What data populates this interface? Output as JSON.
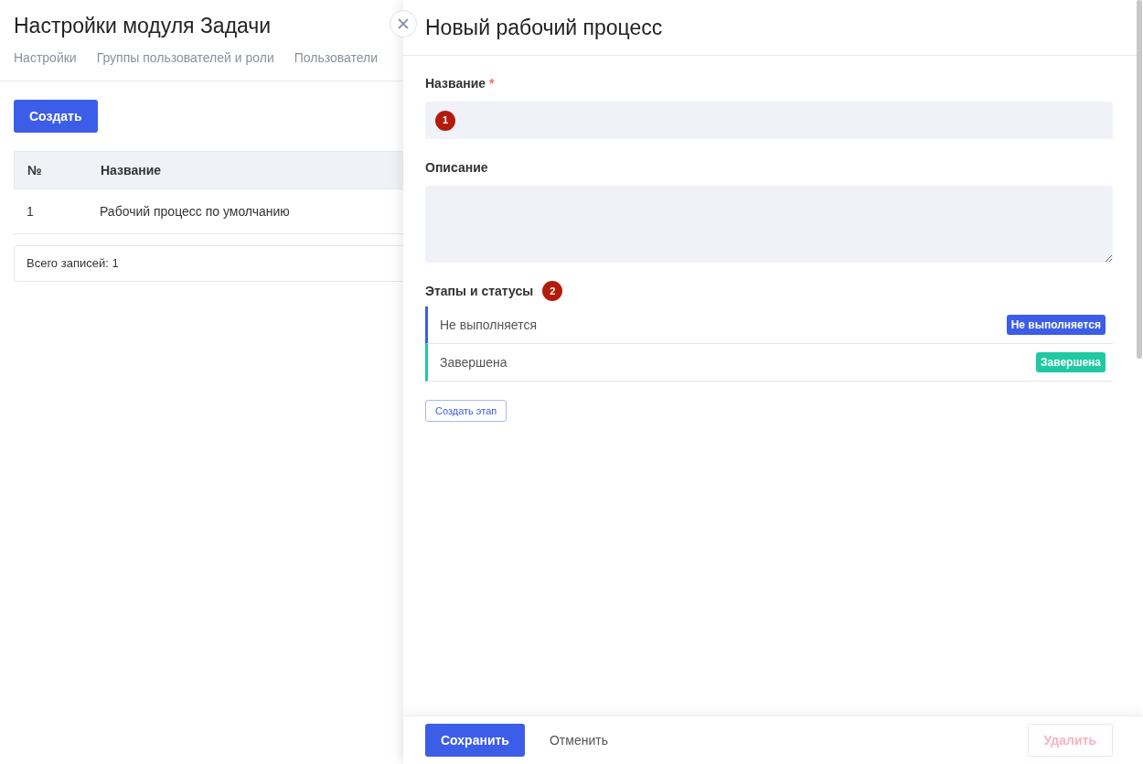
{
  "page": {
    "title": "Настройки модуля Задачи",
    "tabs": [
      {
        "label": "Настройки",
        "selected": false
      },
      {
        "label": "Группы пользователей и роли",
        "selected": false
      },
      {
        "label": "Пользователи",
        "selected": false
      }
    ],
    "create_button": "Создать",
    "table": {
      "columns": [
        "№",
        "Название"
      ],
      "rows": [
        [
          "1",
          "Рабочий процесс по умолчанию"
        ]
      ]
    },
    "total": "Всего записей: 1"
  },
  "drawer": {
    "title": "Новый рабочий процесс",
    "name_field": {
      "label": "Название",
      "required_mark": "*",
      "marker": "1"
    },
    "description_field": {
      "label": "Описание"
    },
    "stages": {
      "label": "Этапы и статусы",
      "marker": "2",
      "items": [
        {
          "name": "Не выполняется",
          "status": "Не выполняется",
          "color": "#3b5de7"
        },
        {
          "name": "Завершена",
          "status": "Завершена",
          "color": "#1fc9a2"
        }
      ],
      "create_button": "Создать этап"
    },
    "footer": {
      "save": "Сохранить",
      "cancel": "Отменить",
      "delete": {
        "label": "Удалить",
        "disabled": true
      }
    }
  }
}
